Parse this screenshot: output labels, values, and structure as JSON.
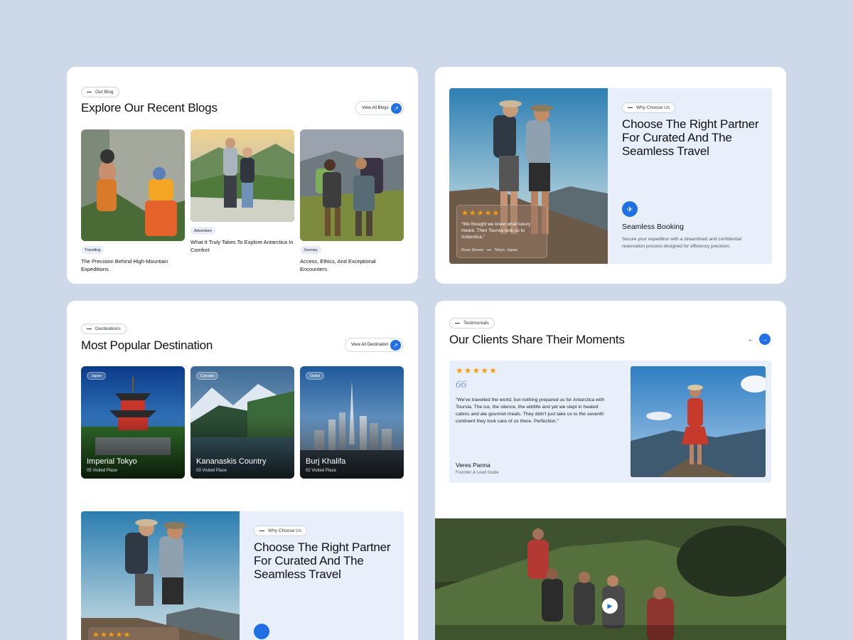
{
  "blog": {
    "pill": "Our Blog",
    "title": "Explore Our Recent Blogs",
    "view_all": "View All Blogs",
    "posts": [
      {
        "tag": "Traveling",
        "title": "The Precision Behind High-Mountain Expeditions"
      },
      {
        "tag": "Adventure",
        "title": "What It Truly Takes To Explore Antarctica In Comfort"
      },
      {
        "tag": "Journey",
        "title": "Access, Ethics, And Exceptional Encounters"
      }
    ]
  },
  "why": {
    "pill": "Why Choose Us",
    "title": "Choose The Right Partner For Curated And The Seamless Travel",
    "rating_stars": "★★★★★",
    "quote": "\"We thought we knew what luxury meant. Then Tourvia took us to Antarctica.\"",
    "quote_author": "Rosa Steven",
    "quote_location": "Tokyo, Japan",
    "feature_title": "Seamless Booking",
    "feature_desc": "Secure your expedition with a streamlined and confidential reservation process designed for efficiency precision."
  },
  "destinations": {
    "pill": "Destinations",
    "title": "Most Popular Destination",
    "view_all": "View All Destination",
    "items": [
      {
        "tag": "Japan",
        "name": "Imperial Tokyo",
        "visited": "05 Visited Place"
      },
      {
        "tag": "Canada",
        "name": "Kananaskis Country",
        "visited": "03 Visited Place"
      },
      {
        "tag": "Dubai",
        "name": "Burj Khalifa",
        "visited": "02 Visited Place"
      }
    ],
    "why_pill": "Why Choose Us",
    "why_title": "Choose The Right Partner For Curated And The Seamless Travel",
    "why_stars": "★★★★★"
  },
  "testimonials": {
    "pill": "Testimonials",
    "title": "Our Clients Share Their Moments",
    "prev_arrow": "←",
    "next_arrow": "→",
    "stars": "★★★★★",
    "quote_mark": "66",
    "quote": "\"We've travelled the world, but nothing prepared us for Antarctica with Tourvia. The ice, the silence, the wildlife and yet we slept in heated cabins and ate gourmet meals. They didn't just take us to the seventh continent they took care of us there. Perfection.\"",
    "author": "Veres Panna",
    "role": "Founder & Lead Guide",
    "play_icon": "▶"
  },
  "colors": {
    "page_bg": "#cdd9e9",
    "accent": "#1f6fe5",
    "panel_bg": "#e8effb",
    "star": "#f59e0b"
  }
}
